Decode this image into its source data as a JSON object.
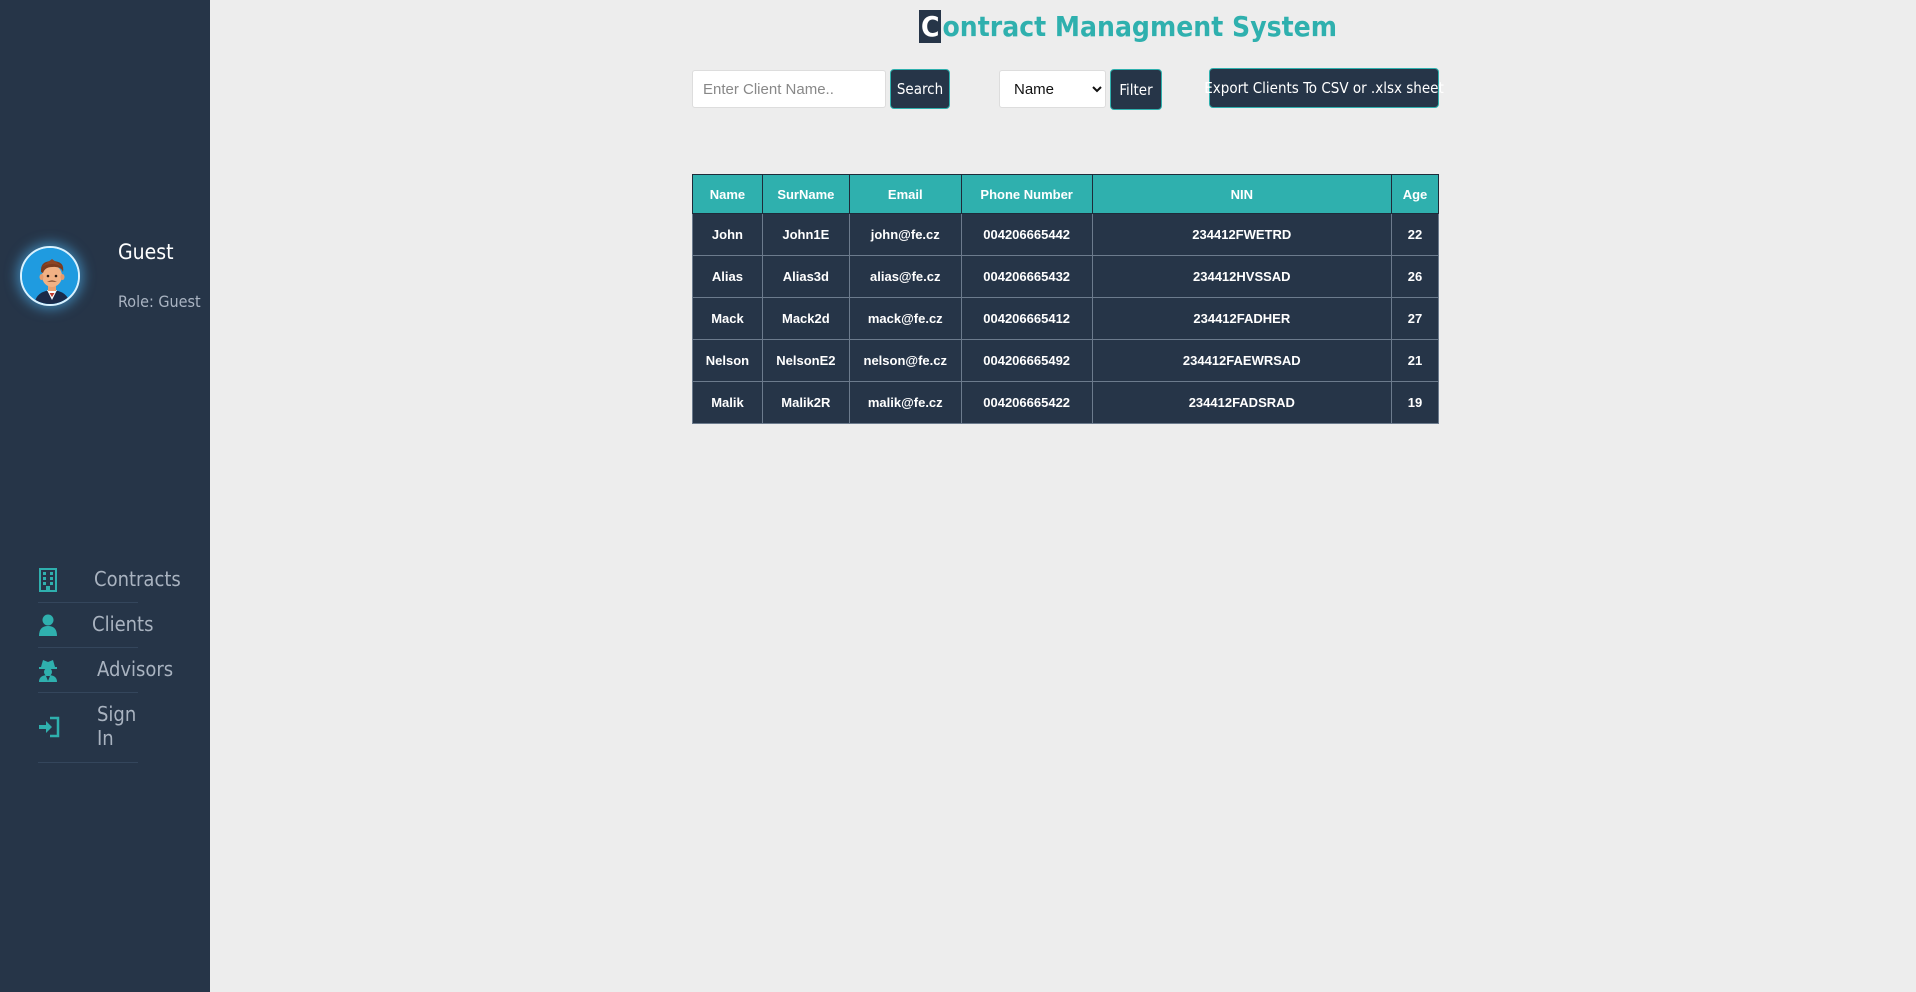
{
  "app": {
    "title_first_letter": "C",
    "title_rest": "ontract Managment System"
  },
  "user": {
    "name": "Guest",
    "role": "Role: Guest"
  },
  "nav": {
    "items": [
      {
        "label": "Contracts",
        "icon": "building-icon"
      },
      {
        "label": "Clients",
        "icon": "user-icon"
      },
      {
        "label": "Advisors",
        "icon": "user-secret-icon"
      },
      {
        "label": "Sign In",
        "icon": "sign-in-icon"
      }
    ]
  },
  "toolbar": {
    "search_placeholder": "Enter Client Name..",
    "search_value": "",
    "search_label": "Search",
    "filter_selected": "Name",
    "filter_label": "Filter",
    "export_label": "Export Clients To CSV or .xlsx sheet"
  },
  "table": {
    "headers": [
      "Name",
      "SurName",
      "Email",
      "Phone Number",
      "NIN",
      "Age"
    ],
    "rows": [
      [
        "John",
        "John1E",
        "john@fe.cz",
        "004206665442",
        "234412FWETRD",
        "22"
      ],
      [
        "Alias",
        "Alias3d",
        "alias@fe.cz",
        "004206665432",
        "234412HVSSAD",
        "26"
      ],
      [
        "Mack",
        "Mack2d",
        "mack@fe.cz",
        "004206665412",
        "234412FADHER",
        "27"
      ],
      [
        "Nelson",
        "NelsonE2",
        "nelson@fe.cz",
        "004206665492",
        "234412FAEWRSAD",
        "21"
      ],
      [
        "Malik",
        "Malik2R",
        "malik@fe.cz",
        "004206665422",
        "234412FADSRAD",
        "19"
      ]
    ]
  },
  "colors": {
    "sidebar": "#263548",
    "accent": "#2fb0ae",
    "background": "#ededed"
  }
}
